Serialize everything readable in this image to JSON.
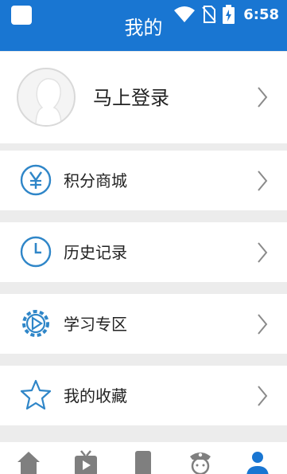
{
  "status_bar": {
    "time": "6:58",
    "icons": [
      "notification-square-icon",
      "wifi-icon",
      "no-sim-icon",
      "battery-charging-icon"
    ]
  },
  "header": {
    "title": "我的"
  },
  "profile": {
    "login_label": "马上登录",
    "avatar_icon": "default-avatar-icon"
  },
  "menu": {
    "items": [
      {
        "label": "积分商城",
        "icon": "yen-coin-icon"
      },
      {
        "label": "历史记录",
        "icon": "clock-icon"
      },
      {
        "label": "学习专区",
        "icon": "gear-play-icon"
      },
      {
        "label": "我的收藏",
        "icon": "star-icon"
      }
    ]
  },
  "bottom_nav": {
    "items": [
      {
        "icon": "home-icon"
      },
      {
        "icon": "tv-icon"
      },
      {
        "icon": "tablet-icon"
      },
      {
        "icon": "police-icon"
      },
      {
        "icon": "person-icon",
        "active": true
      }
    ]
  },
  "colors": {
    "primary": "#1976d2",
    "icon_blue": "#2f86c8",
    "background": "#ececec",
    "nav_inactive": "#7f7f7f"
  }
}
